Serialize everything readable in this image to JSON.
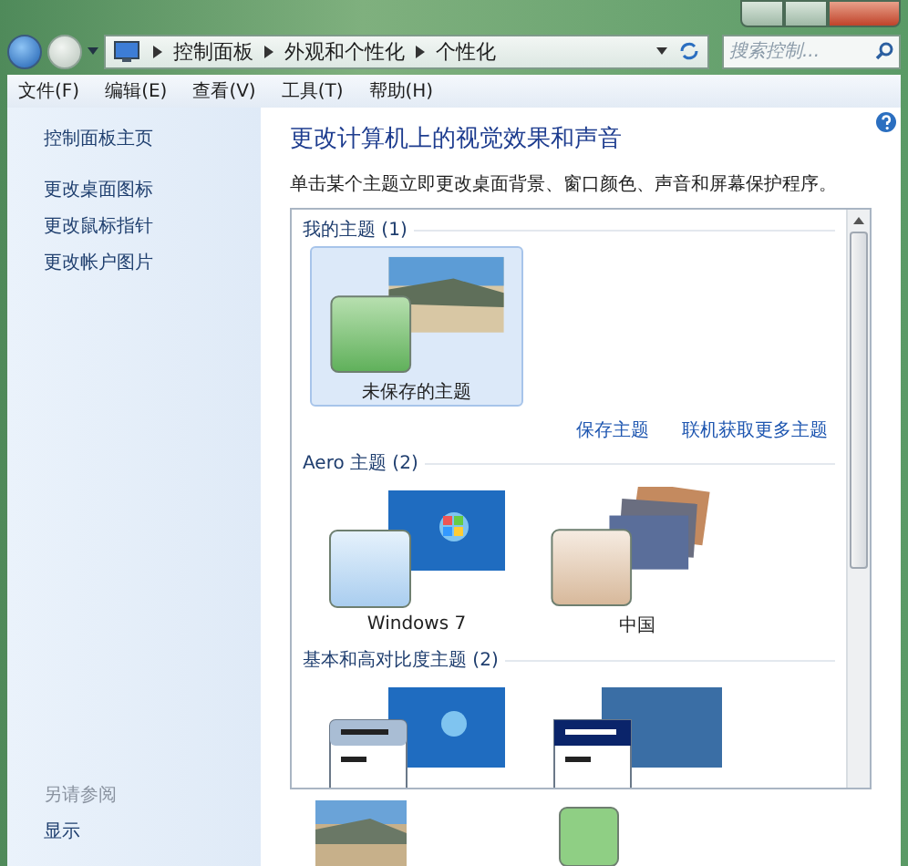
{
  "address_bar": {
    "path": [
      "控制面板",
      "外观和个性化",
      "个性化"
    ],
    "search_placeholder": "搜索控制..."
  },
  "menu_bar": [
    "文件(F)",
    "编辑(E)",
    "查看(V)",
    "工具(T)",
    "帮助(H)"
  ],
  "sidebar": {
    "links": [
      "控制面板主页",
      "更改桌面图标",
      "更改鼠标指针",
      "更改帐户图片"
    ],
    "see_also_title": "另请参阅",
    "see_also_links": [
      "显示"
    ]
  },
  "heading": "更改计算机上的视觉效果和声音",
  "description": "单击某个主题立即更改桌面背景、窗口颜色、声音和屏幕保护程序。",
  "theme_groups": [
    {
      "title": "我的主题 (1)",
      "themes": [
        {
          "name": "未保存的主题",
          "kind": "beach",
          "selected": true
        }
      ],
      "links": [
        "保存主题",
        "联机获取更多主题"
      ]
    },
    {
      "title": "Aero 主题 (2)",
      "themes": [
        {
          "name": "Windows 7",
          "kind": "win7",
          "selected": false
        },
        {
          "name": "中国",
          "kind": "china",
          "selected": false
        }
      ]
    },
    {
      "title": "基本和高对比度主题 (2)",
      "themes": [
        {
          "kind": "basic",
          "selected": false
        },
        {
          "kind": "classic",
          "selected": false
        }
      ]
    }
  ]
}
